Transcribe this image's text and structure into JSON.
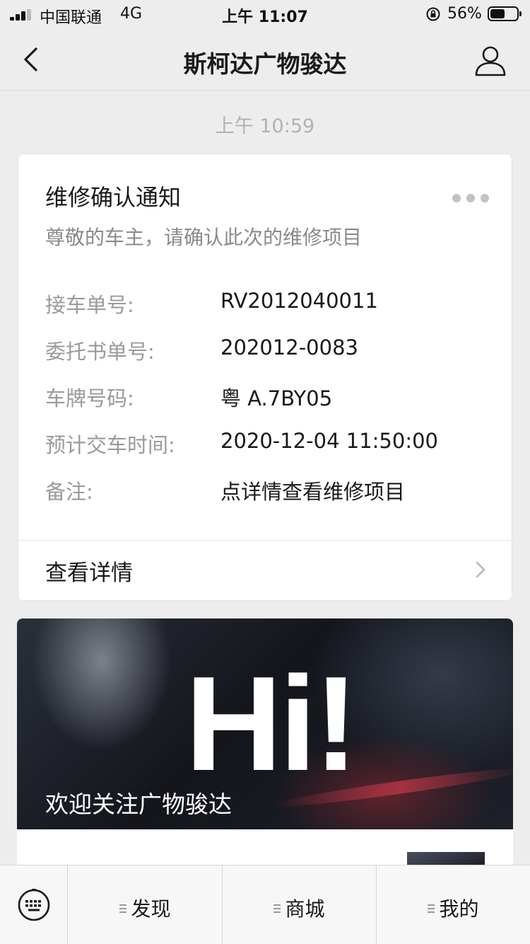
{
  "status_bar": {
    "carrier": "中国联通",
    "network": "4G",
    "time": "上午 11:07",
    "battery_percent": "56%",
    "battery_level": 0.56
  },
  "nav": {
    "title": "斯柯达广物骏达",
    "back_icon": "chevron-left-icon",
    "profile_icon": "user-icon"
  },
  "chat": {
    "timestamp": "上午 10:59"
  },
  "card": {
    "title": "维修确认通知",
    "subtitle": "尊敬的车主，请确认此次的维修项目",
    "rows": [
      {
        "label": "接车单号:",
        "value": "RV2012040011"
      },
      {
        "label": "委托书单号:",
        "value": "202012-0083"
      },
      {
        "label": "车牌号码:",
        "value": "粤 A.7BY05"
      },
      {
        "label": "预计交车时间:",
        "value": "2020-12-04 11:50:00"
      },
      {
        "label": "备注:",
        "value": "点详情查看维修项目"
      }
    ],
    "detail_label": "查看详情"
  },
  "article": {
    "banner_text": "Hi!",
    "caption": "欢迎关注广物骏达"
  },
  "bottom_menu": {
    "keyboard_icon": "keyboard-icon",
    "items": [
      {
        "label": "发现"
      },
      {
        "label": "商城"
      },
      {
        "label": "我的"
      }
    ]
  },
  "colors": {
    "background": "#ededed",
    "card": "#ffffff",
    "label_gray": "#9a9a9a",
    "timestamp_gray": "#b2b2b2"
  }
}
